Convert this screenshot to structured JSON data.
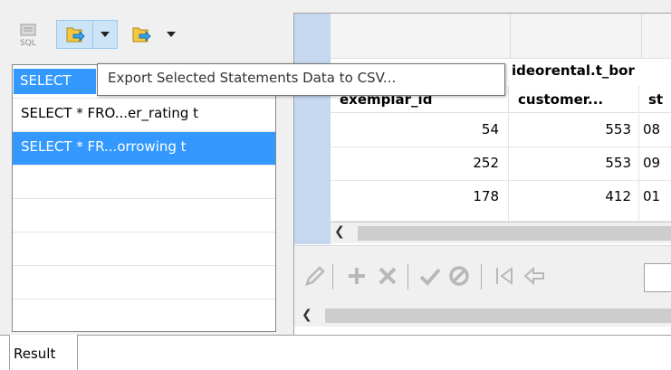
{
  "toolbar": {
    "sql_icon_label": "SQL",
    "icons": [
      "sql-editor-icon",
      "export-icon",
      "chevron-down-icon",
      "export-icon",
      "chevron-down-icon"
    ],
    "selected_bg": "#cce4f7"
  },
  "statements": [
    {
      "label": "SELECT",
      "selected": true
    },
    {
      "label": "SELECT * FRO...er_rating t",
      "selected": false
    },
    {
      "label": "SELECT * FR...orrowing t",
      "selected": true
    }
  ],
  "tooltip": "Export Selected Statements Data to CSV...",
  "grid": {
    "table_title": "ideorental.t_bor",
    "columns": [
      "exemplar_id",
      "customer...",
      "st"
    ],
    "rows": [
      [
        "54",
        "553",
        "08"
      ],
      [
        "252",
        "553",
        "09"
      ],
      [
        "178",
        "412",
        "01"
      ]
    ]
  },
  "editor_icons": [
    "pencil-icon",
    "plus-icon",
    "cross-icon",
    "check-icon",
    "cancel-icon",
    "first-page-icon",
    "prev-page-icon"
  ],
  "tabs": {
    "result": "Result"
  },
  "colors": {
    "selection": "#3399ff",
    "gutter": "#c5d8ef"
  }
}
